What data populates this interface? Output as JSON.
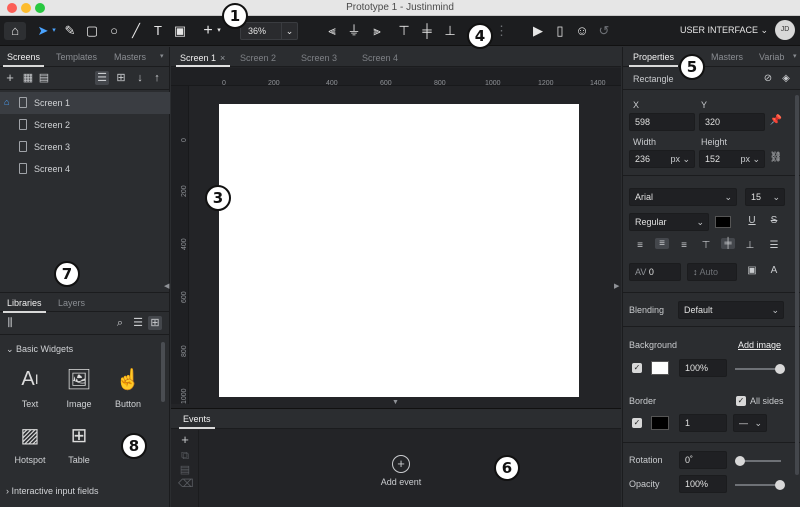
{
  "window": {
    "title": "Prototype 1 - Justinmind"
  },
  "toolbar": {
    "zoom": "36%",
    "ui_mode": "USER INTERFACE",
    "user_initials": "JD"
  },
  "badges": [
    "1",
    "2",
    "3",
    "4",
    "5",
    "6",
    "7",
    "8"
  ],
  "left": {
    "tabs": [
      "Screens",
      "Templates",
      "Masters"
    ],
    "screens": [
      "Screen 1",
      "Screen 2",
      "Screen 3",
      "Screen 4"
    ],
    "lib_tabs": [
      "Libraries",
      "Layers"
    ],
    "section": "Basic Widgets",
    "widgets": [
      "Text",
      "Image",
      "Button",
      "Hotspot",
      "Table"
    ],
    "section2": "Interactive input fields"
  },
  "center": {
    "tabs": [
      "Screen 1",
      "Screen 2",
      "Screen 3",
      "Screen 4"
    ],
    "ruler_top": [
      "0",
      "200",
      "400",
      "600",
      "800",
      "1000",
      "1200",
      "1400"
    ],
    "ruler_left": [
      "0",
      "200",
      "400",
      "600",
      "800",
      "1000"
    ],
    "events_tab": "Events",
    "add_event": "Add event"
  },
  "right": {
    "tabs": [
      "Properties",
      "Masters",
      "Variab"
    ],
    "element": "Rectangle",
    "x_label": "X",
    "x_value": "598",
    "y_label": "Y",
    "y_value": "320",
    "w_label": "Width",
    "w_value": "236",
    "w_unit": "px",
    "h_label": "Height",
    "h_value": "152",
    "h_unit": "px",
    "font": "Arial",
    "font_size": "15",
    "font_style": "Regular",
    "spacing_value": "0",
    "line_height_placeholder": "Auto",
    "blending_label": "Blending",
    "blending_value": "Default",
    "background_label": "Background",
    "add_image": "Add image",
    "bg_opacity": "100%",
    "border_label": "Border",
    "all_sides": "All sides",
    "border_width": "1",
    "rotation_label": "Rotation",
    "rotation_value": "0˚",
    "opacity_label": "Opacity",
    "opacity_value": "100%"
  }
}
